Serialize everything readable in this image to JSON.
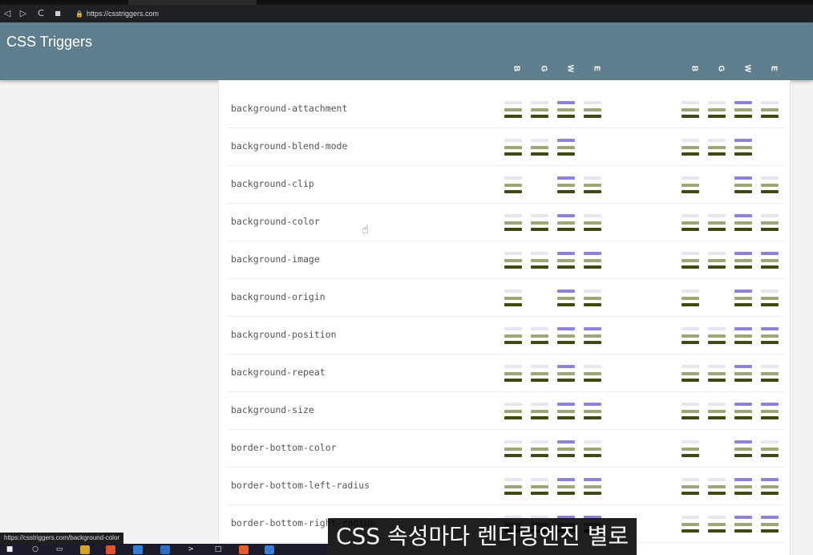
{
  "browser": {
    "back": "◁",
    "forward": "▷",
    "reload": "C",
    "bookmark": "■",
    "url": "https://csstriggers.com"
  },
  "header": {
    "title": "CSS Triggers",
    "column_letters": [
      "B",
      "G",
      "W",
      "E"
    ]
  },
  "properties": [
    "background-attachment",
    "background-blend-mode",
    "background-clip",
    "background-color",
    "background-image",
    "background-origin",
    "background-position",
    "background-repeat",
    "background-size",
    "border-bottom-color",
    "border-bottom-left-radius",
    "border-bottom-right-radius"
  ],
  "status_link": "https://csstriggers.com/background-color",
  "subtitle": "CSS 속성마다 렌더링엔진 별로"
}
